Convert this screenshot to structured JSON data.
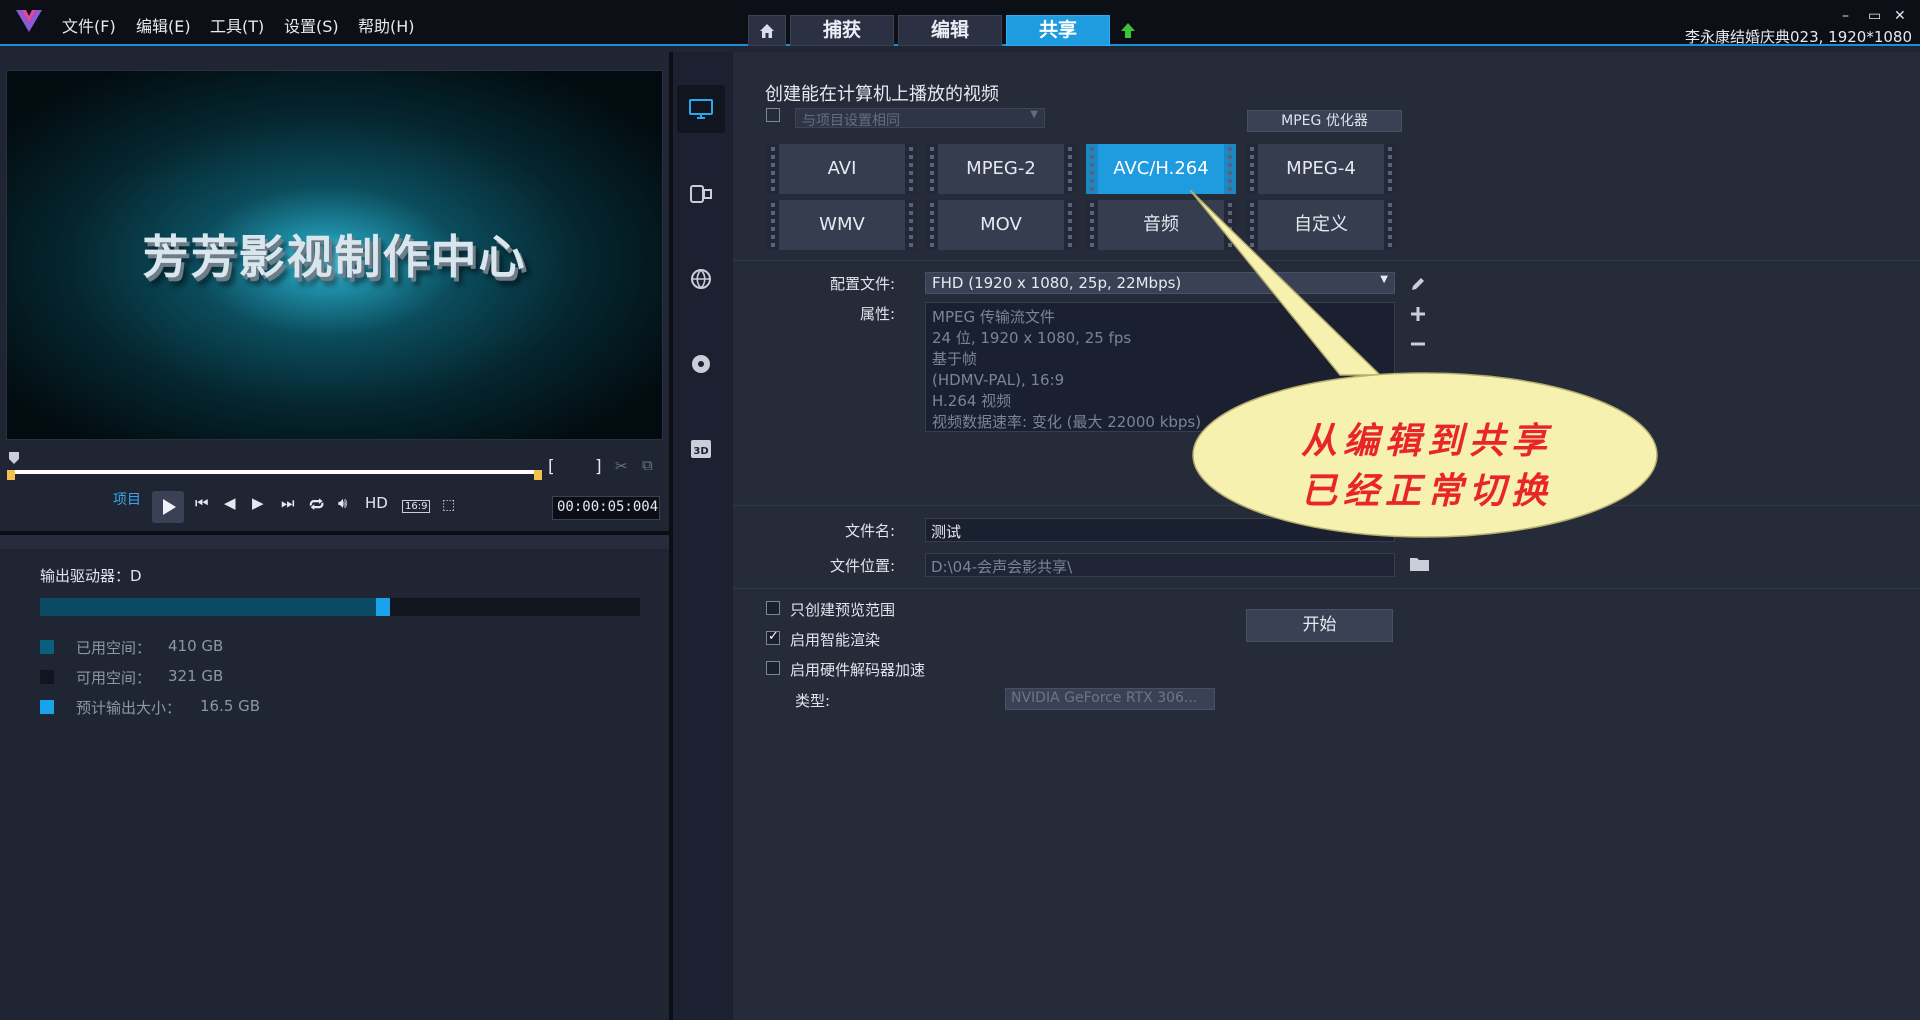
{
  "app": {
    "menu": [
      "文件(F)",
      "编辑(E)",
      "工具(T)",
      "设置(S)",
      "帮助(H)"
    ],
    "nav_tabs": [
      "捕获",
      "编辑",
      "共享"
    ],
    "active_tab": "共享",
    "project_info": "李永康结婚庆典023, 1920*1080",
    "window_controls": [
      "–",
      "▭",
      "✕"
    ]
  },
  "preview": {
    "overlay_text": "芳芳影视制作中心",
    "project_label": "项目",
    "hd_label": "HD",
    "aspect_label": "16:9",
    "timecode": "00:00:05:004",
    "mark_in": "[",
    "mark_out": "]"
  },
  "drive": {
    "label": "输出驱动器：D",
    "used_fraction": 0.56,
    "legend": [
      {
        "label": "已用空间：",
        "value": "410 GB",
        "color": "#0b5f7e"
      },
      {
        "label": "可用空间：",
        "value": "321 GB",
        "color": "#11151f"
      },
      {
        "label": "预计输出大小：",
        "value": "16.5 GB",
        "color": "#1aa3ea"
      }
    ]
  },
  "share": {
    "title": "创建能在计算机上播放的视频",
    "same_as_project": "与项目设置相同",
    "mpeg_optimizer": "MPEG 优化器",
    "formats": [
      "AVI",
      "MPEG-2",
      "AVC/H.264",
      "MPEG-4",
      "WMV",
      "MOV",
      "音频",
      "自定义"
    ],
    "selected_format": "AVC/H.264",
    "profile_label": "配置文件:",
    "profile_value": "FHD (1920 x 1080, 25p, 22Mbps)",
    "properties_label": "属性:",
    "properties": [
      "MPEG 传输流文件",
      "24 位, 1920 x 1080, 25 fps",
      "基于帧",
      "(HDMV-PAL),  16:9",
      "H.264 视频",
      "视频数据速率: 变化 (最大 22000 kbps)"
    ],
    "filename_label": "文件名:",
    "filename_value": "测试",
    "location_label": "文件位置:",
    "location_value": "D:\\04-会声会影共享\\",
    "options": [
      {
        "label": "只创建预览范围",
        "checked": false
      },
      {
        "label": "启用智能渲染",
        "checked": true
      },
      {
        "label": "启用硬件解码器加速",
        "checked": false
      }
    ],
    "start_label": "开始",
    "type_label": "类型:",
    "gpu_value": "NVIDIA GeForce RTX 306..."
  },
  "callout": {
    "line1": "从编辑到共享",
    "line2": "已经正常切换"
  }
}
